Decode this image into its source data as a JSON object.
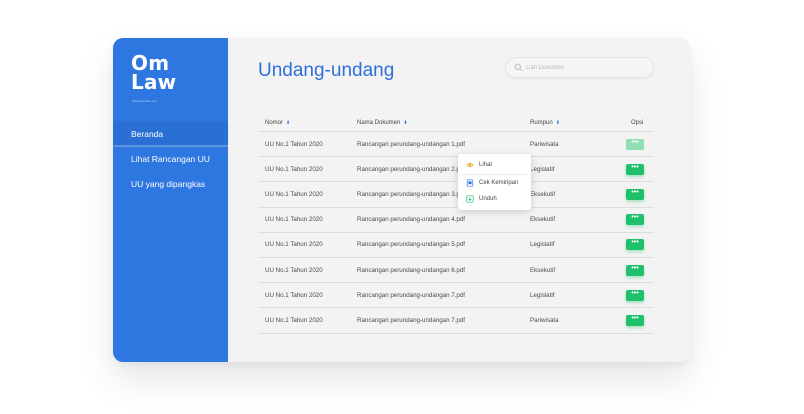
{
  "sidebar": {
    "logo_line1": "Om",
    "logo_line2": "Law",
    "tagline": "Aplikasi Omnibus Law",
    "items": [
      {
        "label": "Beranda",
        "active": true
      },
      {
        "label": "Lihat Rancangan UU",
        "active": false
      },
      {
        "label": "UU yang dipangkas",
        "active": false
      }
    ]
  },
  "main": {
    "title": "Undang-undang",
    "search": {
      "placeholder": "Cari Dokumen",
      "value": ""
    }
  },
  "table": {
    "headers": [
      "Nomor",
      "Nama Dokumen",
      "Rumpun",
      "Opsi"
    ],
    "rows": [
      {
        "nomor": "UU No.1 Tahun 2020",
        "nama": "Rancangan perundang-undangan 1.pdf",
        "rumpun": "Pariwisata"
      },
      {
        "nomor": "UU No.1 Tahun 2020",
        "nama": "Rancangan perundang-undangan 2.pdf",
        "rumpun": "Legislatif"
      },
      {
        "nomor": "UU No.1 Tahun 2020",
        "nama": "Rancangan perundang-undangan 3.pdf",
        "rumpun": "Eksekutif"
      },
      {
        "nomor": "UU No.1 Tahun 2020",
        "nama": "Rancangan perundang-undangan 4.pdf",
        "rumpun": "Eksekutif"
      },
      {
        "nomor": "UU No.1 Tahun 2020",
        "nama": "Rancangan perundang-undangan 5.pdf",
        "rumpun": "Legislatif"
      },
      {
        "nomor": "UU No.1 Tahun 2020",
        "nama": "Rancangan perundang-undangan 6.pdf",
        "rumpun": "Eksekutif"
      },
      {
        "nomor": "UU No.1 Tahun 2020",
        "nama": "Rancangan perundang-undangan 7.pdf",
        "rumpun": "Legislatif"
      },
      {
        "nomor": "UU No.1 Tahun 2020",
        "nama": "Rancangan perundang-undangan 7.pdf",
        "rumpun": "Pariwisata"
      }
    ],
    "options_label": "•••",
    "sort_glyph": "⬍"
  },
  "menu": {
    "items": [
      {
        "label": "Lihat",
        "icon": "eye-icon"
      },
      {
        "label": "Cek Kemiripan",
        "icon": "document-compare-icon"
      },
      {
        "label": "Unduh",
        "icon": "download-icon"
      }
    ]
  },
  "colors": {
    "sidebar": "#2e77e0",
    "title": "#2f6fdb",
    "option_button": "#1fc06b",
    "option_button_active": "#8fdfb3",
    "menu_icon_eye": "#f0a500",
    "menu_icon_doc": "#2e77e0",
    "menu_icon_download": "#1fc06b"
  }
}
